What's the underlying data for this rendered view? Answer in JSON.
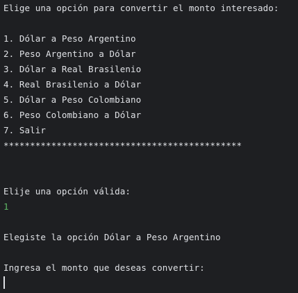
{
  "console": {
    "prompt_title": "Elige una opción para convertir el monto interesado:",
    "options": [
      "1. Dólar a Peso Argentino",
      "2. Peso Argentino a Dólar",
      "3. Dólar a Real Brasilenio",
      "4. Real Brasilenio a Dólar",
      "5. Dólar a Peso Colombiano",
      "6. Peso Colombiano a Dólar",
      "7. Salir"
    ],
    "separator": "*********************************************",
    "choose_prompt": "Elije una opción válida:",
    "user_input": "1",
    "chosen_message": "Elegiste la opción Dólar a Peso Argentino",
    "amount_prompt": "Ingresa el monto que deseas convertir:"
  },
  "colors": {
    "background": "#1e1f22",
    "text": "#dfe1e5",
    "user_input": "#5fb865"
  }
}
